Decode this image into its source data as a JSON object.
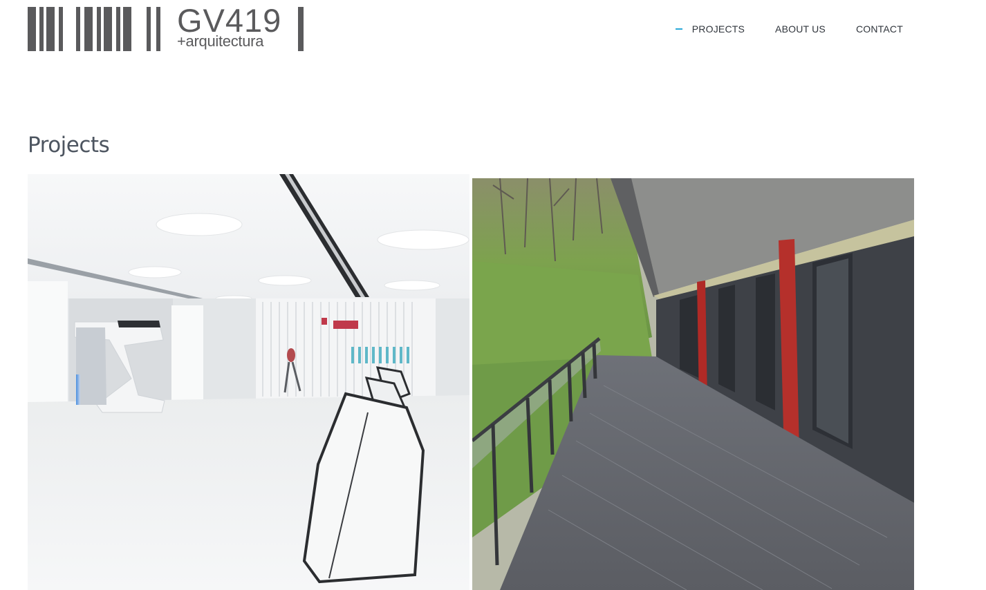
{
  "logo": {
    "main_text": "GV419",
    "sub_text": "+arquitectura"
  },
  "nav": {
    "items": [
      {
        "label": "PROJECTS",
        "active": true
      },
      {
        "label": "ABOUT US",
        "active": false
      },
      {
        "label": "CONTACT",
        "active": false
      }
    ]
  },
  "page": {
    "title": "Projects"
  },
  "projects": [
    {
      "image": "white-interior-hall-photo"
    },
    {
      "image": "wooden-terrace-red-columns-photo"
    }
  ],
  "colors": {
    "accent": "#29a9d8",
    "logo": "#5a5a5c",
    "text": "#2f343b",
    "title": "#4d5560"
  }
}
